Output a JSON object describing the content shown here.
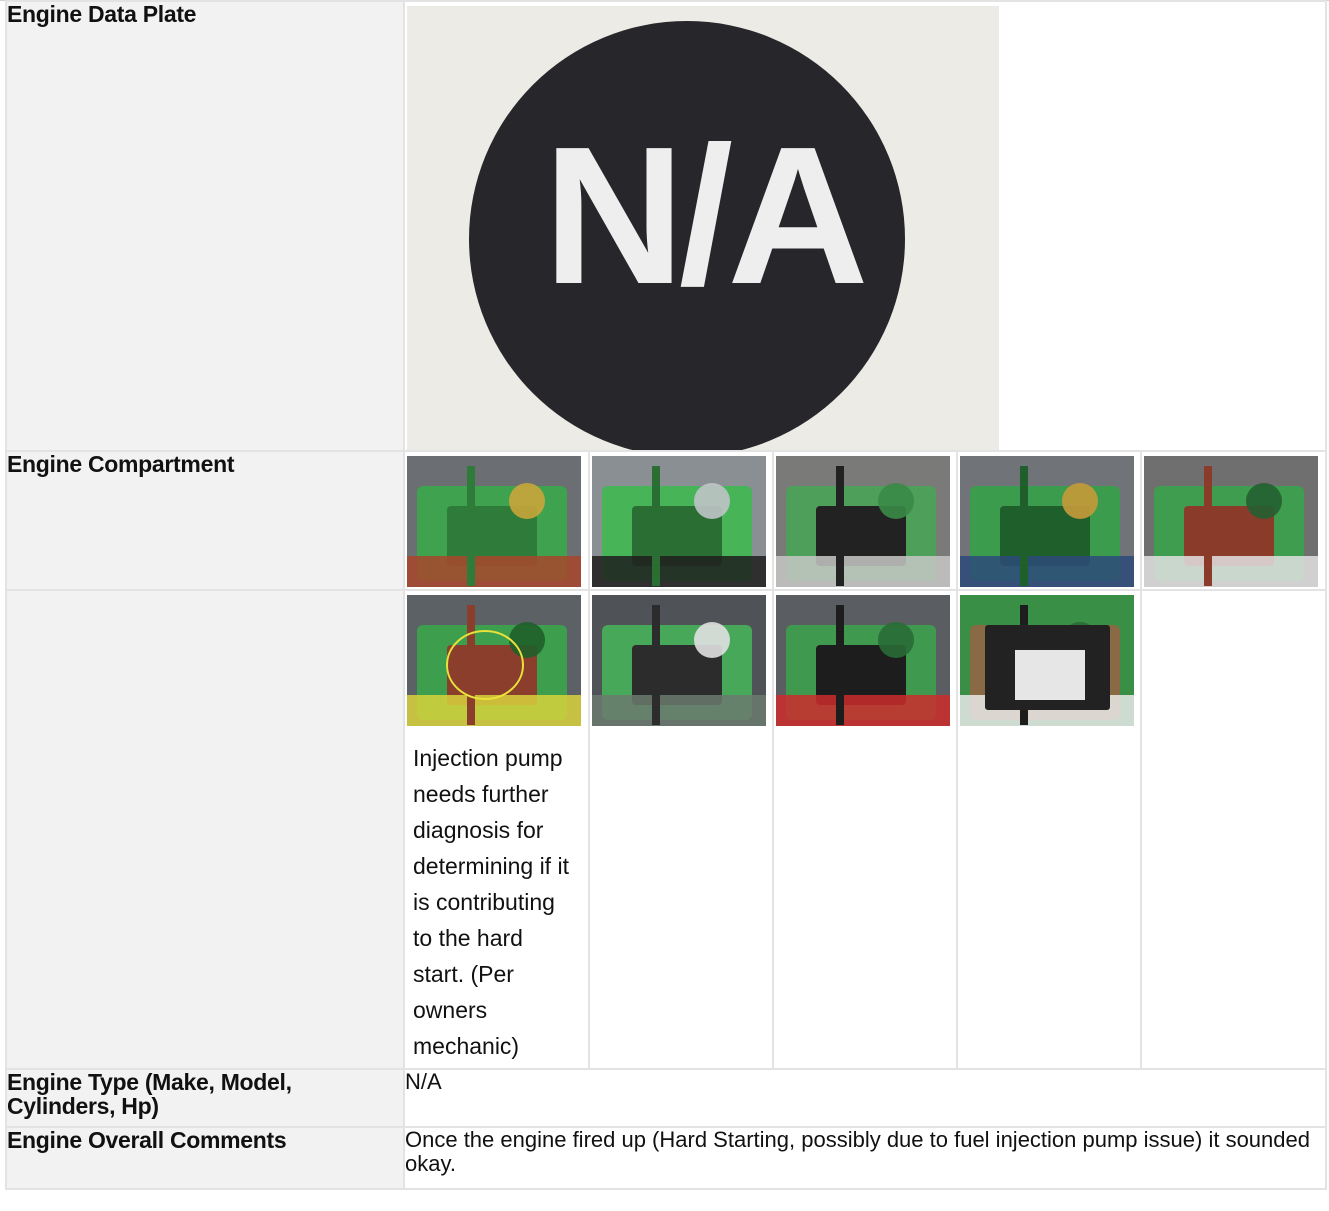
{
  "rows": {
    "data_plate": {
      "label": "Engine Data Plate",
      "plate_text": "N/A"
    },
    "compartment": {
      "label": "Engine Compartment",
      "photos_row1": [
        "engine-photo-1",
        "engine-photo-2",
        "engine-photo-3",
        "engine-photo-4",
        "engine-photo-5"
      ],
      "photos_row2": [
        "injection-pump-photo",
        "fuel-lines-photo",
        "starter-photo",
        "battery-photo"
      ],
      "caption": "Injection pump needs further diagnosis for determining if it is contributing to the hard start. (Per owners mechanic)"
    },
    "engine_type": {
      "label": "Engine Type (Make, Model, Cylinders, Hp)",
      "value": "N/A"
    },
    "overall_comments": {
      "label": "Engine Overall Comments",
      "value": "Once the engine fired up (Hard Starting, possibly due to fuel injection pump issue) it sounded okay."
    }
  },
  "colors": {
    "label_bg": "#f2f2f2",
    "border": "#e3e3e3",
    "engine_green": "#3a9a4a"
  }
}
